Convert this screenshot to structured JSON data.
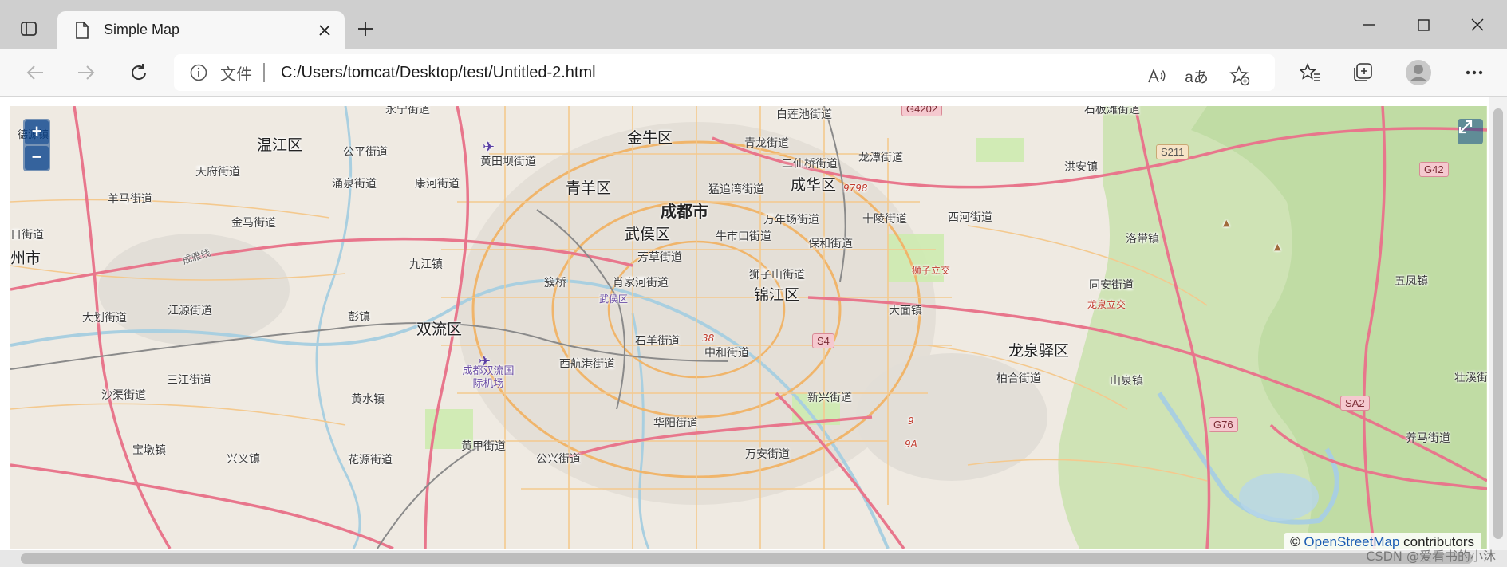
{
  "browser": {
    "tab_title": "Simple Map",
    "address_prefix": "文件",
    "url": "C:/Users/tomcat/Desktop/test/Untitled-2.html",
    "read_aloud_label": "A",
    "translate_label": "aあ"
  },
  "map": {
    "zoom_in_label": "+",
    "zoom_out_label": "−",
    "attribution_symbol": "©",
    "attribution_link": "OpenStreetMap",
    "attribution_suffix": "contributors",
    "labels": {
      "chengdu": "成都市",
      "wenjiang": "温江区",
      "jinniu": "金牛区",
      "qingyang": "青羊区",
      "chenghua": "成华区",
      "wuhou": "武侯区",
      "jinjiang": "锦江区",
      "shuangliu": "双流区",
      "longquanyi": "龙泉驿区",
      "gongping": "公平街道",
      "tianfu": "天府街道",
      "yongquan": "涌泉街道",
      "kanghe": "康河街道",
      "huangtianba": "黄田坝街道",
      "baiyechi": "白莲池街道",
      "qinglong": "青龙街道",
      "erxianqiao": "二仙桥街道",
      "longtan": "龙潭街道",
      "mengzhuiwan": "猛追湾街道",
      "yangma": "羊马街道",
      "jinma": "金马街道",
      "wannianchang": "万年场街道",
      "shiling": "十陵街道",
      "xihe": "西河街道",
      "niushikou": "牛市口街道",
      "baohe": "保和街道",
      "fangcao": "芳草街道",
      "jiujiang": "九江镇",
      "suqiao": "簇桥",
      "xiaojiahe": "肖家河街道",
      "shizishan": "狮子山街道",
      "luodai": "洛带镇",
      "tongan": "同安街道",
      "wufeng": "五凤镇",
      "jiangyuan": "江源街道",
      "dahua": "大划街道",
      "pengzhen": "彭镇",
      "damian": "大面镇",
      "shiyang": "石羊街道",
      "zhonghe": "中和街道",
      "sanjiang": "三江街道",
      "xihang": "西航港街道",
      "baihe": "柏合街道",
      "shanquan": "山泉镇",
      "shaqu": "沙渠街道",
      "huangshui": "黄水镇",
      "xinxing": "新兴街道",
      "huayang": "华阳街道",
      "huangjia": "黄甲街道",
      "baodun": "宝墩镇",
      "xingyi": "兴义镇",
      "huayuan": "花源街道",
      "gongxing": "公兴街道",
      "wanan": "万安街道",
      "yangma2": "养马街道",
      "zhuxi": "壮溪街",
      "hongchang": "洪安镇",
      "airport": "成都双流国际机场",
      "wuhou_small": "武侯区",
      "shizi_interchange": "狮子立交",
      "longquan_interchange": "龙泉立交",
      "left_street": "日街道",
      "left_city": "州市",
      "top_street": "永宁街道",
      "top_river": "石板滩街道",
      "decheng": "德源镇",
      "chengya": "成雅线"
    },
    "shields": {
      "s211": "S211",
      "g42": "G42",
      "g4202": "G4202",
      "s4": "S4",
      "sa2": "SA2",
      "g76": "G76",
      "r9798": "9798",
      "r38": "38",
      "r9": "9",
      "r9a": "9A"
    }
  },
  "watermark": "CSDN @爱看书的小沐"
}
